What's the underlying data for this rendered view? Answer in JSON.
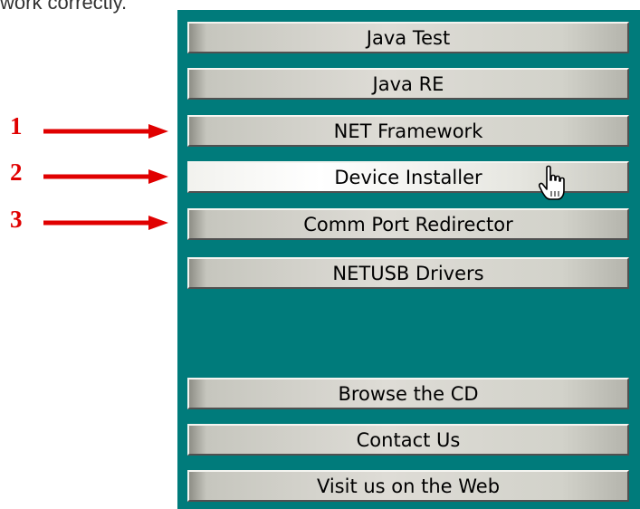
{
  "top_text": "work correctly.",
  "menu": {
    "buttons": [
      {
        "label": "Java Test",
        "name": "java-test-button"
      },
      {
        "label": "Java RE",
        "name": "java-re-button"
      },
      {
        "label": "NET Framework",
        "name": "net-framework-button"
      },
      {
        "label": "Device Installer",
        "name": "device-installer-button",
        "hovered": true
      },
      {
        "label": "Comm Port Redirector",
        "name": "comm-port-redirector-button"
      },
      {
        "label": "NETUSB Drivers",
        "name": "netusb-drivers-button"
      },
      {
        "label": "Browse the CD",
        "name": "browse-cd-button"
      },
      {
        "label": "Contact Us",
        "name": "contact-us-button"
      },
      {
        "label": "Visit us on the Web",
        "name": "visit-web-button"
      }
    ]
  },
  "annotations": [
    {
      "number": "1",
      "points_to": "NET Framework"
    },
    {
      "number": "2",
      "points_to": "Device Installer"
    },
    {
      "number": "3",
      "points_to": "Comm Port Redirector"
    }
  ],
  "colors": {
    "panel_background": "#007b7b",
    "annotation": "#e00000"
  },
  "cursor_icon": "hand-pointer-icon"
}
